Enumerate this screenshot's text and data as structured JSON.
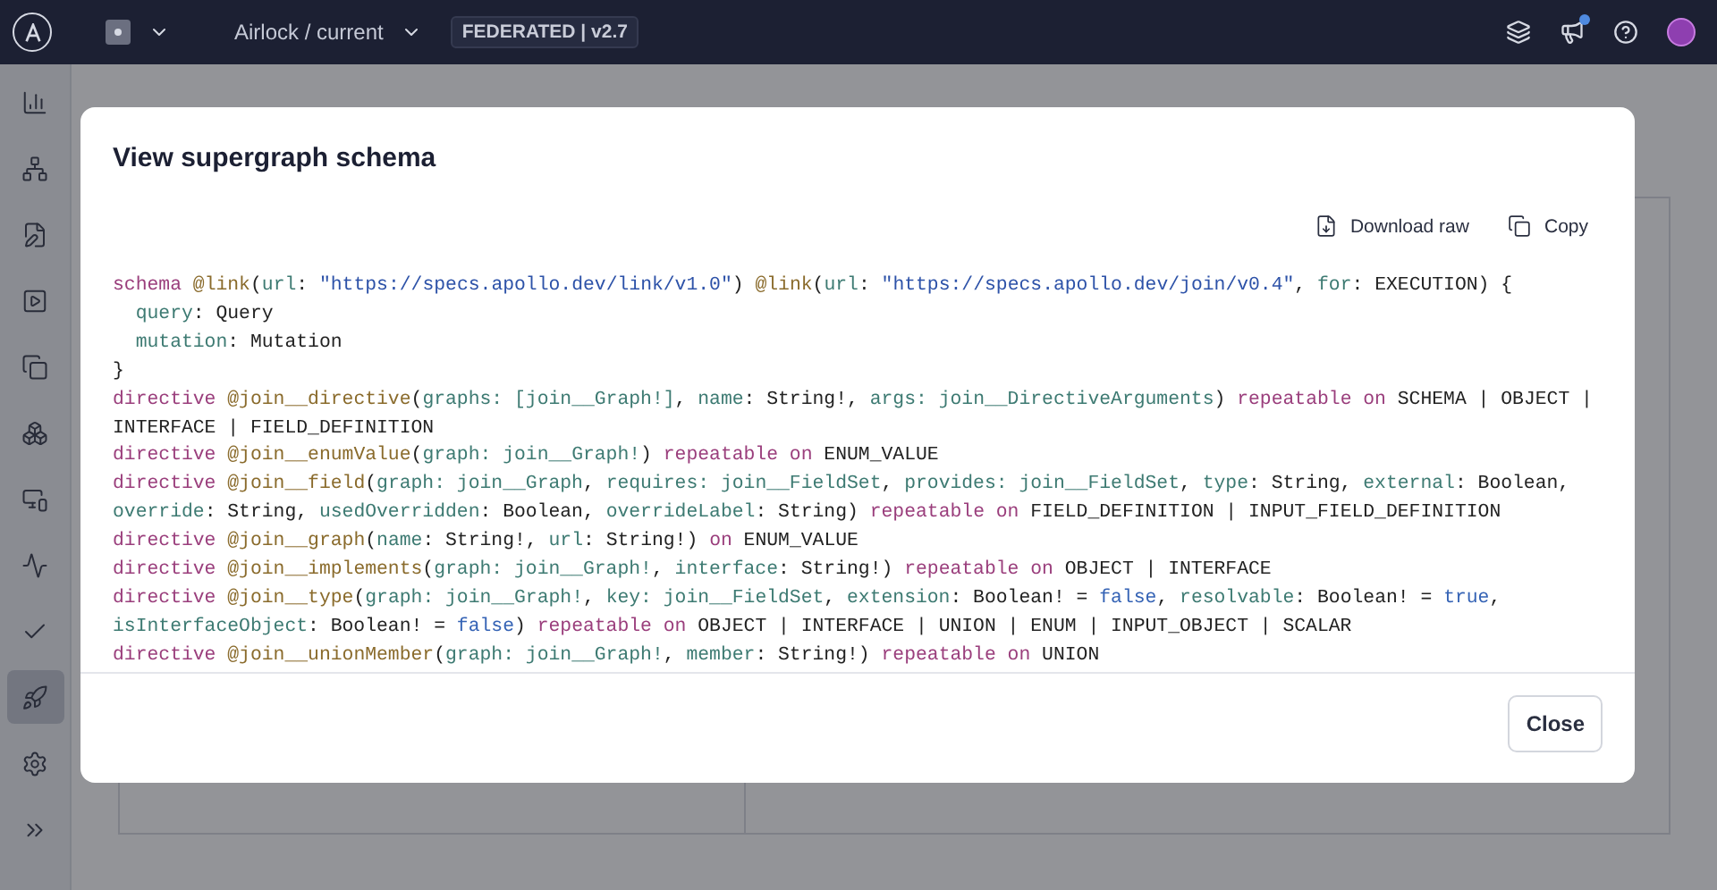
{
  "top_bar": {
    "project": "Airlock / current",
    "badge": "FEDERATED | v2.7",
    "notification_dot": true
  },
  "sidebar": {
    "items": [
      {
        "kind": "chart",
        "selected": false
      },
      {
        "kind": "graph",
        "selected": false
      },
      {
        "kind": "edit",
        "selected": false
      },
      {
        "kind": "play",
        "selected": false
      },
      {
        "kind": "copy",
        "selected": false
      },
      {
        "kind": "cubes",
        "selected": false
      },
      {
        "kind": "monitor",
        "selected": false
      },
      {
        "kind": "pulse",
        "selected": false
      },
      {
        "kind": "check",
        "selected": false
      },
      {
        "kind": "rocket",
        "selected": true
      },
      {
        "kind": "gear",
        "selected": false
      }
    ]
  },
  "modal": {
    "title": "View supergraph schema",
    "actions": [
      {
        "kind": "download",
        "label": "Download raw"
      },
      {
        "kind": "copy",
        "label": "Copy"
      }
    ],
    "code_lines": [
      [
        {
          "kind": "kw",
          "text": "schema "
        },
        {
          "kind": "dir",
          "text": "@link"
        },
        {
          "kind": "p",
          "text": "("
        },
        {
          "kind": "f",
          "text": "url"
        },
        {
          "kind": "p",
          "text": ": "
        },
        {
          "kind": "s",
          "text": "\"https://specs.apollo.dev/link/v1.0\""
        },
        {
          "kind": "p",
          "text": ") "
        },
        {
          "kind": "dir",
          "text": "@link"
        },
        {
          "kind": "p",
          "text": "("
        },
        {
          "kind": "f",
          "text": "url"
        },
        {
          "kind": "p",
          "text": ": "
        },
        {
          "kind": "s",
          "text": "\"https://specs.apollo.dev/join/v0.4\""
        },
        {
          "kind": "p",
          "text": ", "
        },
        {
          "kind": "f",
          "text": "for"
        },
        {
          "kind": "p",
          "text": ": EXECUTION) {"
        }
      ],
      [
        {
          "kind": "f",
          "text": "  query"
        },
        {
          "kind": "p",
          "text": ": Query"
        }
      ],
      [
        {
          "kind": "f",
          "text": "  mutation"
        },
        {
          "kind": "p",
          "text": ": Mutation"
        }
      ],
      [
        {
          "kind": "p",
          "text": "}"
        }
      ],
      [
        {
          "kind": "kw",
          "text": "directive "
        },
        {
          "kind": "dir",
          "text": "@join__directive"
        },
        {
          "kind": "p",
          "text": "("
        },
        {
          "kind": "f",
          "text": "graphs: [join__Graph!]"
        },
        {
          "kind": "p",
          "text": ", "
        },
        {
          "kind": "f",
          "text": "name"
        },
        {
          "kind": "p",
          "text": ": String!, "
        },
        {
          "kind": "f",
          "text": "args: join__DirectiveArguments"
        },
        {
          "kind": "p",
          "text": ") "
        },
        {
          "kind": "kw",
          "text": "repeatable on"
        },
        {
          "kind": "p",
          "text": " SCHEMA | OBJECT |"
        }
      ],
      [
        {
          "kind": "p",
          "text": "INTERFACE | FIELD_DEFINITION"
        }
      ],
      [
        {
          "kind": "kw",
          "text": "directive "
        },
        {
          "kind": "dir",
          "text": "@join__enumValue"
        },
        {
          "kind": "p",
          "text": "("
        },
        {
          "kind": "f",
          "text": "graph: join__Graph!"
        },
        {
          "kind": "p",
          "text": ") "
        },
        {
          "kind": "kw",
          "text": "repeatable on"
        },
        {
          "kind": "p",
          "text": " ENUM_VALUE"
        }
      ],
      [
        {
          "kind": "kw",
          "text": "directive "
        },
        {
          "kind": "dir",
          "text": "@join__field"
        },
        {
          "kind": "p",
          "text": "("
        },
        {
          "kind": "f",
          "text": "graph: join__Graph"
        },
        {
          "kind": "p",
          "text": ", "
        },
        {
          "kind": "f",
          "text": "requires: join__FieldSet"
        },
        {
          "kind": "p",
          "text": ", "
        },
        {
          "kind": "f",
          "text": "provides: join__FieldSet"
        },
        {
          "kind": "p",
          "text": ", "
        },
        {
          "kind": "f",
          "text": "type"
        },
        {
          "kind": "p",
          "text": ": String, "
        },
        {
          "kind": "f",
          "text": "external"
        },
        {
          "kind": "p",
          "text": ": Boolean,"
        }
      ],
      [
        {
          "kind": "f",
          "text": "override"
        },
        {
          "kind": "p",
          "text": ": String, "
        },
        {
          "kind": "f",
          "text": "usedOverridden"
        },
        {
          "kind": "p",
          "text": ": Boolean, "
        },
        {
          "kind": "f",
          "text": "overrideLabel"
        },
        {
          "kind": "p",
          "text": ": String) "
        },
        {
          "kind": "kw",
          "text": "repeatable on"
        },
        {
          "kind": "p",
          "text": " FIELD_DEFINITION | INPUT_FIELD_DEFINITION"
        }
      ],
      [
        {
          "kind": "kw",
          "text": "directive "
        },
        {
          "kind": "dir",
          "text": "@join__graph"
        },
        {
          "kind": "p",
          "text": "("
        },
        {
          "kind": "f",
          "text": "name"
        },
        {
          "kind": "p",
          "text": ": String!, "
        },
        {
          "kind": "f",
          "text": "url"
        },
        {
          "kind": "p",
          "text": ": String!) "
        },
        {
          "kind": "kw",
          "text": "on"
        },
        {
          "kind": "p",
          "text": " ENUM_VALUE"
        }
      ],
      [
        {
          "kind": "kw",
          "text": "directive "
        },
        {
          "kind": "dir",
          "text": "@join__implements"
        },
        {
          "kind": "p",
          "text": "("
        },
        {
          "kind": "f",
          "text": "graph: join__Graph!"
        },
        {
          "kind": "p",
          "text": ", "
        },
        {
          "kind": "f",
          "text": "interface"
        },
        {
          "kind": "p",
          "text": ": String!) "
        },
        {
          "kind": "kw",
          "text": "repeatable on"
        },
        {
          "kind": "p",
          "text": " OBJECT | INTERFACE"
        }
      ],
      [
        {
          "kind": "kw",
          "text": "directive "
        },
        {
          "kind": "dir",
          "text": "@join__type"
        },
        {
          "kind": "p",
          "text": "("
        },
        {
          "kind": "f",
          "text": "graph: join__Graph!"
        },
        {
          "kind": "p",
          "text": ", "
        },
        {
          "kind": "f",
          "text": "key: join__FieldSet"
        },
        {
          "kind": "p",
          "text": ", "
        },
        {
          "kind": "f",
          "text": "extension"
        },
        {
          "kind": "p",
          "text": ": Boolean! = "
        },
        {
          "kind": "val",
          "text": "false"
        },
        {
          "kind": "p",
          "text": ", "
        },
        {
          "kind": "f",
          "text": "resolvable"
        },
        {
          "kind": "p",
          "text": ": Boolean! = "
        },
        {
          "kind": "val",
          "text": "true"
        },
        {
          "kind": "p",
          "text": ","
        }
      ],
      [
        {
          "kind": "f",
          "text": "isInterfaceObject"
        },
        {
          "kind": "p",
          "text": ": Boolean! = "
        },
        {
          "kind": "val",
          "text": "false"
        },
        {
          "kind": "p",
          "text": ") "
        },
        {
          "kind": "kw",
          "text": "repeatable on"
        },
        {
          "kind": "p",
          "text": " OBJECT | INTERFACE | UNION | ENUM | INPUT_OBJECT | SCALAR"
        }
      ],
      [
        {
          "kind": "kw",
          "text": "directive "
        },
        {
          "kind": "dir",
          "text": "@join__unionMember"
        },
        {
          "kind": "p",
          "text": "("
        },
        {
          "kind": "f",
          "text": "graph: join__Graph!"
        },
        {
          "kind": "p",
          "text": ", "
        },
        {
          "kind": "f",
          "text": "member"
        },
        {
          "kind": "p",
          "text": ": String!) "
        },
        {
          "kind": "kw",
          "text": "repeatable on"
        },
        {
          "kind": "p",
          "text": " UNION"
        }
      ]
    ],
    "close_label": "Close"
  }
}
